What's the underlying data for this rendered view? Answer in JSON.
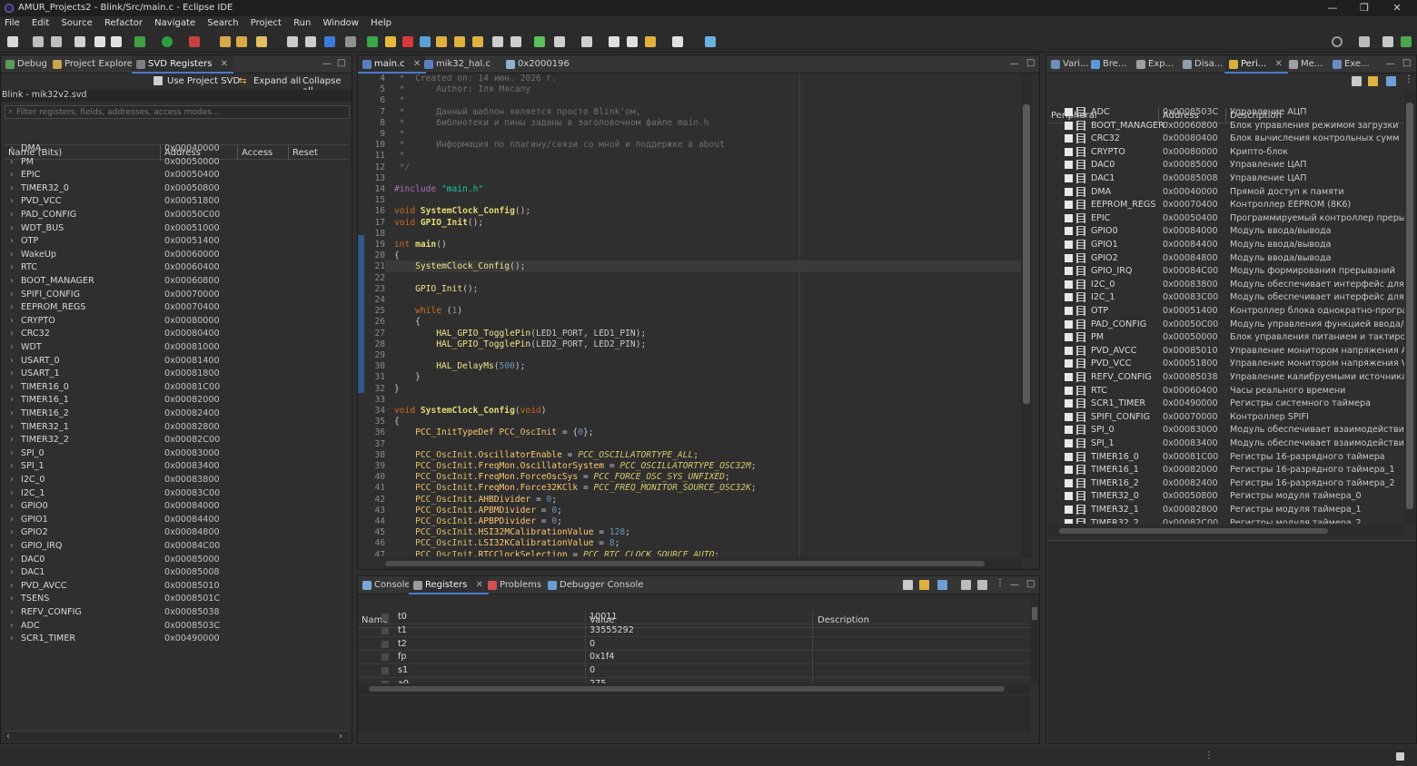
{
  "window": {
    "title": "AMUR_Projects2 - Blink/Src/main.c - Eclipse IDE",
    "controls": [
      "—",
      "❐",
      "✕"
    ]
  },
  "menu": [
    "File",
    "Edit",
    "Source",
    "Refactor",
    "Navigate",
    "Search",
    "Project",
    "Run",
    "Window",
    "Help"
  ],
  "left_panel": {
    "tabs": [
      "Debug",
      "Project Explorer",
      "SVD Registers"
    ],
    "actions": [
      "Use Project SVD",
      "Expand all",
      "Collapse all"
    ],
    "svd_file": "Blink - mik32v2.svd",
    "filter_placeholder": "Filter registers, fields, addresses, access modes...",
    "columns": [
      "Name (Bits)",
      "Address",
      "Access",
      "Reset"
    ],
    "rows": [
      [
        "DMA",
        "0x00040000"
      ],
      [
        "PM",
        "0x00050000"
      ],
      [
        "EPIC",
        "0x00050400"
      ],
      [
        "TIMER32_0",
        "0x00050800"
      ],
      [
        "PVD_VCC",
        "0x00051800"
      ],
      [
        "PAD_CONFIG",
        "0x00050C00"
      ],
      [
        "WDT_BUS",
        "0x00051000"
      ],
      [
        "OTP",
        "0x00051400"
      ],
      [
        "WakeUp",
        "0x00060000"
      ],
      [
        "RTC",
        "0x00060400"
      ],
      [
        "BOOT_MANAGER",
        "0x00060800"
      ],
      [
        "SPIFI_CONFIG",
        "0x00070000"
      ],
      [
        "EEPROM_REGS",
        "0x00070400"
      ],
      [
        "CRYPTO",
        "0x00080000"
      ],
      [
        "CRC32",
        "0x00080400"
      ],
      [
        "WDT",
        "0x00081000"
      ],
      [
        "USART_0",
        "0x00081400"
      ],
      [
        "USART_1",
        "0x00081800"
      ],
      [
        "TIMER16_0",
        "0x00081C00"
      ],
      [
        "TIMER16_1",
        "0x00082000"
      ],
      [
        "TIMER16_2",
        "0x00082400"
      ],
      [
        "TIMER32_1",
        "0x00082800"
      ],
      [
        "TIMER32_2",
        "0x00082C00"
      ],
      [
        "SPI_0",
        "0x00083000"
      ],
      [
        "SPI_1",
        "0x00083400"
      ],
      [
        "I2C_0",
        "0x00083800"
      ],
      [
        "I2C_1",
        "0x00083C00"
      ],
      [
        "GPIO0",
        "0x00084000"
      ],
      [
        "GPIO1",
        "0x00084400"
      ],
      [
        "GPIO2",
        "0x00084800"
      ],
      [
        "GPIO_IRQ",
        "0x00084C00"
      ],
      [
        "DAC0",
        "0x00085000"
      ],
      [
        "DAC1",
        "0x00085008"
      ],
      [
        "PVD_AVCC",
        "0x00085010"
      ],
      [
        "TSENS",
        "0x0008501C"
      ],
      [
        "REFV_CONFIG",
        "0x00085038"
      ],
      [
        "ADC",
        "0x0008503C"
      ],
      [
        "SCR1_TIMER",
        "0x00490000"
      ]
    ]
  },
  "editor": {
    "tabs": [
      "main.c",
      "mik32_hal.c",
      "0x2000196"
    ],
    "lines": [
      {
        "n": "4",
        "parts": [
          [
            "cm",
            " *  Created on: 14 июн. 2026 г."
          ]
        ]
      },
      {
        "n": "5",
        "parts": [
          [
            "cm",
            " *      Author: Іля Мясапу"
          ]
        ]
      },
      {
        "n": "6",
        "parts": [
          [
            "cm",
            " *"
          ]
        ]
      },
      {
        "n": "7",
        "parts": [
          [
            "cm",
            " *      Данный шаблон является просто Blink'ом,"
          ]
        ]
      },
      {
        "n": "8",
        "parts": [
          [
            "cm",
            " *      библиотеки и пины заданы в заголовочном файле main.h"
          ]
        ]
      },
      {
        "n": "9",
        "parts": [
          [
            "cm",
            " *"
          ]
        ]
      },
      {
        "n": "10",
        "parts": [
          [
            "cm",
            " *      Информация по плагину/связи со мной и поддержке в about"
          ]
        ]
      },
      {
        "n": "11",
        "parts": [
          [
            "cm",
            " *"
          ]
        ]
      },
      {
        "n": "12",
        "parts": [
          [
            "cm",
            " */"
          ]
        ]
      },
      {
        "n": "13",
        "parts": []
      },
      {
        "n": "14",
        "parts": [
          [
            "mc",
            "#include "
          ],
          [
            "st",
            "\"main.h\""
          ]
        ]
      },
      {
        "n": "15",
        "parts": []
      },
      {
        "n": "16",
        "parts": [
          [
            "kw",
            "void "
          ],
          [
            "fn",
            "SystemClock_Config"
          ],
          [
            "",
            "();"
          ]
        ]
      },
      {
        "n": "17",
        "parts": [
          [
            "kw",
            "void "
          ],
          [
            "fn",
            "GPIO_Init"
          ],
          [
            "",
            "();"
          ]
        ]
      },
      {
        "n": "18",
        "parts": []
      },
      {
        "n": "19",
        "parts": [
          [
            "kw",
            "int "
          ],
          [
            "fn",
            "main"
          ],
          [
            "",
            "()"
          ]
        ]
      },
      {
        "n": "20",
        "parts": [
          [
            "",
            "{"
          ]
        ]
      },
      {
        "n": "21",
        "parts": [
          [
            "",
            "    "
          ],
          [
            "fnc",
            "SystemClock_Config"
          ],
          [
            "",
            "();"
          ]
        ]
      },
      {
        "n": "22",
        "parts": []
      },
      {
        "n": "23",
        "parts": [
          [
            "",
            "    "
          ],
          [
            "fnc",
            "GPIO_Init"
          ],
          [
            "",
            "();"
          ]
        ]
      },
      {
        "n": "24",
        "parts": []
      },
      {
        "n": "25",
        "parts": [
          [
            "",
            "    "
          ],
          [
            "kw",
            "while "
          ],
          [
            "",
            "("
          ],
          [
            "num",
            "1"
          ],
          [
            "",
            ")"
          ]
        ]
      },
      {
        "n": "26",
        "parts": [
          [
            "",
            "    {"
          ]
        ]
      },
      {
        "n": "27",
        "parts": [
          [
            "",
            "        "
          ],
          [
            "fnc",
            "HAL_GPIO_TogglePin"
          ],
          [
            "",
            "(LED1_PORT, LED1_PIN);"
          ]
        ]
      },
      {
        "n": "28",
        "parts": [
          [
            "",
            "        "
          ],
          [
            "fnc",
            "HAL_GPIO_TogglePin"
          ],
          [
            "",
            "(LED2_PORT, LED2_PIN);"
          ]
        ]
      },
      {
        "n": "29",
        "parts": []
      },
      {
        "n": "30",
        "parts": [
          [
            "",
            "        "
          ],
          [
            "fnc",
            "HAL_DelayMs"
          ],
          [
            "",
            "("
          ],
          [
            "num",
            "500"
          ],
          [
            "",
            ");"
          ]
        ]
      },
      {
        "n": "31",
        "parts": [
          [
            "",
            "    }"
          ]
        ]
      },
      {
        "n": "32",
        "parts": [
          [
            "",
            "}"
          ]
        ]
      },
      {
        "n": "33",
        "parts": []
      },
      {
        "n": "34",
        "parts": [
          [
            "kw",
            "void "
          ],
          [
            "fn",
            "SystemClock_Config"
          ],
          [
            "",
            "("
          ],
          [
            "kw",
            "void"
          ],
          [
            "",
            ")"
          ]
        ]
      },
      {
        "n": "35",
        "parts": [
          [
            "",
            "{"
          ]
        ]
      },
      {
        "n": "36",
        "parts": [
          [
            "",
            "    "
          ],
          [
            "ty",
            "PCC_InitTypeDef "
          ],
          [
            "var",
            "PCC_OscInit"
          ],
          [
            "",
            " = {"
          ],
          [
            "num",
            "0"
          ],
          [
            "",
            "};"
          ]
        ]
      },
      {
        "n": "37",
        "parts": []
      },
      {
        "n": "38",
        "parts": [
          [
            "",
            "    "
          ],
          [
            "var",
            "PCC_OscInit"
          ],
          [
            "",
            "."
          ],
          [
            "ty",
            "OscillatorEnable"
          ],
          [
            "",
            " = "
          ],
          [
            "it",
            "PCC_OSCILLATORTYPE_ALL"
          ],
          [
            "",
            ";"
          ]
        ]
      },
      {
        "n": "39",
        "parts": [
          [
            "",
            "    "
          ],
          [
            "var",
            "PCC_OscInit"
          ],
          [
            "",
            "."
          ],
          [
            "ty",
            "FreqMon.OscillatorSystem"
          ],
          [
            "",
            " = "
          ],
          [
            "it",
            "PCC_OSCILLATORTYPE_OSC32M"
          ],
          [
            "",
            ";"
          ]
        ]
      },
      {
        "n": "40",
        "parts": [
          [
            "",
            "    "
          ],
          [
            "var",
            "PCC_OscInit"
          ],
          [
            "",
            "."
          ],
          [
            "ty",
            "FreqMon.ForceOscSys"
          ],
          [
            "",
            " = "
          ],
          [
            "it",
            "PCC_FORCE_OSC_SYS_UNFIXED"
          ],
          [
            "",
            ";"
          ]
        ]
      },
      {
        "n": "41",
        "parts": [
          [
            "",
            "    "
          ],
          [
            "var",
            "PCC_OscInit"
          ],
          [
            "",
            "."
          ],
          [
            "ty",
            "FreqMon.Force32KClk"
          ],
          [
            "",
            " = "
          ],
          [
            "it",
            "PCC_FREQ_MONITOR_SOURCE_OSC32K"
          ],
          [
            "",
            ";"
          ]
        ]
      },
      {
        "n": "42",
        "parts": [
          [
            "",
            "    "
          ],
          [
            "var",
            "PCC_OscInit"
          ],
          [
            "",
            "."
          ],
          [
            "ty",
            "AHBDivider"
          ],
          [
            "",
            " = "
          ],
          [
            "num",
            "0"
          ],
          [
            "",
            ";"
          ]
        ]
      },
      {
        "n": "43",
        "parts": [
          [
            "",
            "    "
          ],
          [
            "var",
            "PCC_OscInit"
          ],
          [
            "",
            "."
          ],
          [
            "ty",
            "APBMDivider"
          ],
          [
            "",
            " = "
          ],
          [
            "num",
            "0"
          ],
          [
            "",
            ";"
          ]
        ]
      },
      {
        "n": "44",
        "parts": [
          [
            "",
            "    "
          ],
          [
            "var",
            "PCC_OscInit"
          ],
          [
            "",
            "."
          ],
          [
            "ty",
            "APBPDivider"
          ],
          [
            "",
            " = "
          ],
          [
            "num",
            "0"
          ],
          [
            "",
            ";"
          ]
        ]
      },
      {
        "n": "45",
        "parts": [
          [
            "",
            "    "
          ],
          [
            "var",
            "PCC_OscInit"
          ],
          [
            "",
            "."
          ],
          [
            "ty",
            "HSI32MCalibrationValue"
          ],
          [
            "",
            " = "
          ],
          [
            "num",
            "128"
          ],
          [
            "",
            ";"
          ]
        ]
      },
      {
        "n": "46",
        "parts": [
          [
            "",
            "    "
          ],
          [
            "var",
            "PCC_OscInit"
          ],
          [
            "",
            "."
          ],
          [
            "ty",
            "LSI32KCalibrationValue"
          ],
          [
            "",
            " = "
          ],
          [
            "num",
            "8"
          ],
          [
            "",
            ";"
          ]
        ]
      },
      {
        "n": "47",
        "parts": [
          [
            "",
            "    "
          ],
          [
            "var",
            "PCC_OscInit"
          ],
          [
            "",
            "."
          ],
          [
            "ty",
            "RTCClockSelection"
          ],
          [
            "",
            " = "
          ],
          [
            "it",
            "PCC_RTC_CLOCK_SOURCE_AUTO"
          ],
          [
            "",
            ";"
          ]
        ]
      }
    ]
  },
  "bottom_panel": {
    "tabs": [
      "Console",
      "Registers",
      "Problems",
      "Debugger Console"
    ],
    "columns": [
      "Name",
      "Value",
      "Description"
    ],
    "rows": [
      [
        "t0",
        "10011"
      ],
      [
        "t1",
        "33555292"
      ],
      [
        "t2",
        "0"
      ],
      [
        "fp",
        "0x1f4"
      ],
      [
        "s1",
        "0"
      ],
      [
        "a0",
        "275"
      ]
    ]
  },
  "right_panel": {
    "tabs": [
      "Vari...",
      "Bre...",
      "Exp...",
      "Disa...",
      "Peri...",
      "Me...",
      "Exe..."
    ],
    "columns": [
      "Peripheral",
      "Address",
      "Description"
    ],
    "rows": [
      [
        "ADC",
        "0x0008503C",
        "Управление АЦП"
      ],
      [
        "BOOT_MANAGER",
        "0x00060800",
        "Блок управления режимом загрузки"
      ],
      [
        "CRC32",
        "0x00080400",
        "Блок вычисления контрольных сумм"
      ],
      [
        "CRYPTO",
        "0x00080000",
        "Крипто-блок"
      ],
      [
        "DAC0",
        "0x00085000",
        "Управление ЦАП"
      ],
      [
        "DAC1",
        "0x00085008",
        "Управление ЦАП"
      ],
      [
        "DMA",
        "0x00040000",
        "Прямой доступ к памяти"
      ],
      [
        "EEPROM_REGS",
        "0x00070400",
        "Контроллер EEPROM (8K6)"
      ],
      [
        "EPIC",
        "0x00050400",
        "Программируемый контроллер прерыван"
      ],
      [
        "GPIO0",
        "0x00084000",
        "Модуль ввода/вывода"
      ],
      [
        "GPIO1",
        "0x00084400",
        "Модуль ввода/вывода"
      ],
      [
        "GPIO2",
        "0x00084800",
        "Модуль ввода/вывода"
      ],
      [
        "GPIO_IRQ",
        "0x00084C00",
        "Модуль формирования прерываний"
      ],
      [
        "I2C_0",
        "0x00083800",
        "Модуль обеспечивает интерфейс для связи"
      ],
      [
        "I2C_1",
        "0x00083C00",
        "Модуль обеспечивает интерфейс для связи"
      ],
      [
        "OTP",
        "0x00051400",
        "Контроллер блока однократно-программи"
      ],
      [
        "PAD_CONFIG",
        "0x00050C00",
        "Модуль управления функцией ввода/выво,"
      ],
      [
        "PM",
        "0x00050000",
        "Блок управления питанием и тактирование"
      ],
      [
        "PVD_AVCC",
        "0x00085010",
        "Управление монитором напряжения AVCC"
      ],
      [
        "PVD_VCC",
        "0x00051800",
        "Управление монитором напряжения VCC"
      ],
      [
        "REFV_CONFIG",
        "0x00085038",
        "Управление калибруемыми источниками"
      ],
      [
        "RTC",
        "0x00060400",
        "Часы реального времени"
      ],
      [
        "SCR1_TIMER",
        "0x00490000",
        "Регистры системного таймера"
      ],
      [
        "SPIFI_CONFIG",
        "0x00070000",
        "Контроллер SPIFI"
      ],
      [
        "SPI_0",
        "0x00083000",
        "Модуль обеспечивает взаимодействие с ра"
      ],
      [
        "SPI_1",
        "0x00083400",
        "Модуль обеспечивает взаимодействие с ра"
      ],
      [
        "TIMER16_0",
        "0x00081C00",
        "Регистры 16-разрядного таймера"
      ],
      [
        "TIMER16_1",
        "0x00082000",
        "Регистры 16-разрядного таймера_1"
      ],
      [
        "TIMER16_2",
        "0x00082400",
        "Регистры 16-разрядного таймера_2"
      ],
      [
        "TIMER32_0",
        "0x00050800",
        "Регистры модуля таймера_0"
      ],
      [
        "TIMER32_1",
        "0x00082800",
        "Регистры модуля таймера_1"
      ],
      [
        "TIMER32_2",
        "0x00082C00",
        "Регистры модуля таймера_2"
      ]
    ]
  },
  "colors": {
    "accent": "#4a7bd0",
    "keyword": "#cc6c1d",
    "string": "#17c6a3",
    "comment": "#707070"
  }
}
